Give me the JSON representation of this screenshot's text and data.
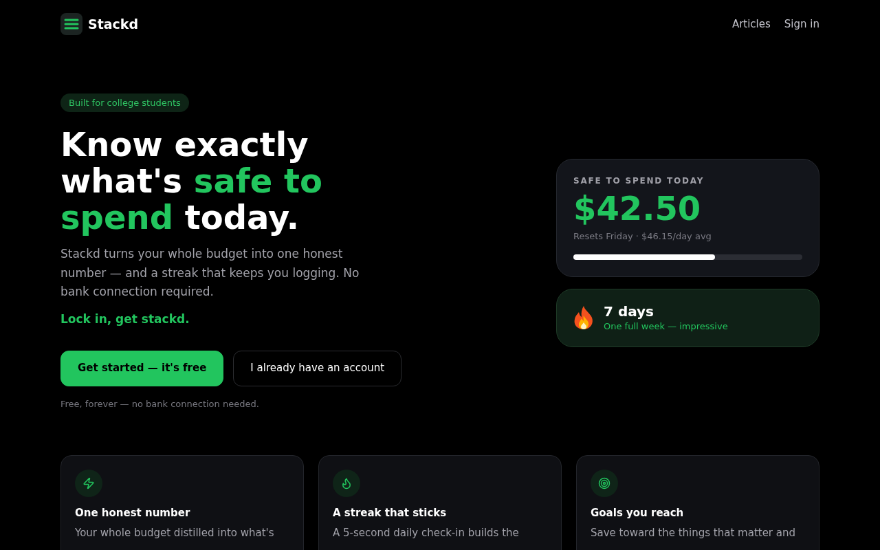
{
  "nav": {
    "brand": "Stackd",
    "links": [
      {
        "label": "Articles"
      },
      {
        "label": "Sign in"
      }
    ]
  },
  "hero": {
    "badge": "Built for college students",
    "headline": [
      {
        "text": "Know exactly what's ",
        "highlight": false
      },
      {
        "text": "safe to spend",
        "highlight": true
      },
      {
        "text": " today.",
        "highlight": false
      }
    ],
    "description": "Stackd turns your whole budget into one honest number — and a streak that keeps you logging. No bank connection required.",
    "tagline": "Lock in, get stackd.",
    "buttons": [
      {
        "label": "Get started — it's free",
        "kind": "primary"
      },
      {
        "label": "I already have an account",
        "kind": "secondary"
      }
    ],
    "footnote": "Free, forever — no bank connection needed."
  },
  "budget_card": {
    "label": "SAFE TO SPEND TODAY",
    "amount": "$42.50",
    "subtitle": "Resets Friday · $46.15/day avg",
    "level": 0.62
  },
  "streak_card": {
    "title": "7 days",
    "subtitle": "One full week — impressive"
  },
  "features": [
    {
      "title": "One honest number",
      "description": "Your whole budget distilled into what's"
    },
    {
      "title": "A streak that sticks",
      "description": "A 5-second daily check-in builds the"
    },
    {
      "title": "Goals you reach",
      "description": "Save toward the things that matter and"
    }
  ]
}
